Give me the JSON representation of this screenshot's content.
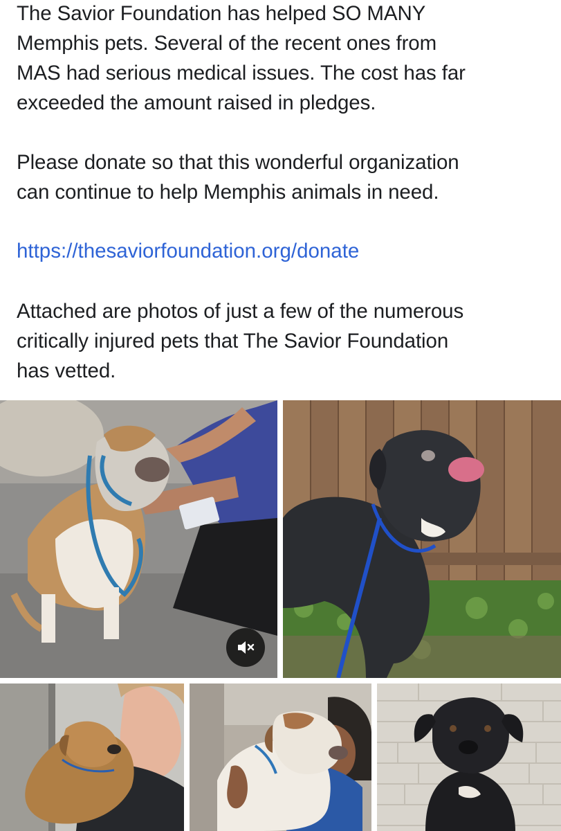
{
  "post": {
    "paragraph_1": "The Savior Foundation has helped SO MANY\nMemphis pets. Several of the recent ones from\nMAS had serious medical issues. The cost has far\nexceeded the amount raised in pledges.",
    "paragraph_2": "Please donate so that this wonderful organization\ncan continue to help Memphis animals in need.",
    "link_text": "https://thesaviorfoundation.org/donate",
    "paragraph_3": "Attached are photos of just a few of the numerous\ncritically injured pets that The Savior Foundation\nhas vetted."
  },
  "colors": {
    "text": "#1c1e21",
    "link": "#2e63d6",
    "background": "#ffffff"
  },
  "photos": [
    {
      "name": "tan-white-pit-bull-with-shelter-worker",
      "has_video_control": true
    },
    {
      "name": "black-dog-licking-nose-by-fence"
    },
    {
      "name": "puppy-hugged-by-woman"
    },
    {
      "name": "dog-hugged-by-person"
    },
    {
      "name": "black-dog-portrait"
    }
  ],
  "media_controls": {
    "mute_icon": "speaker-muted-icon"
  }
}
